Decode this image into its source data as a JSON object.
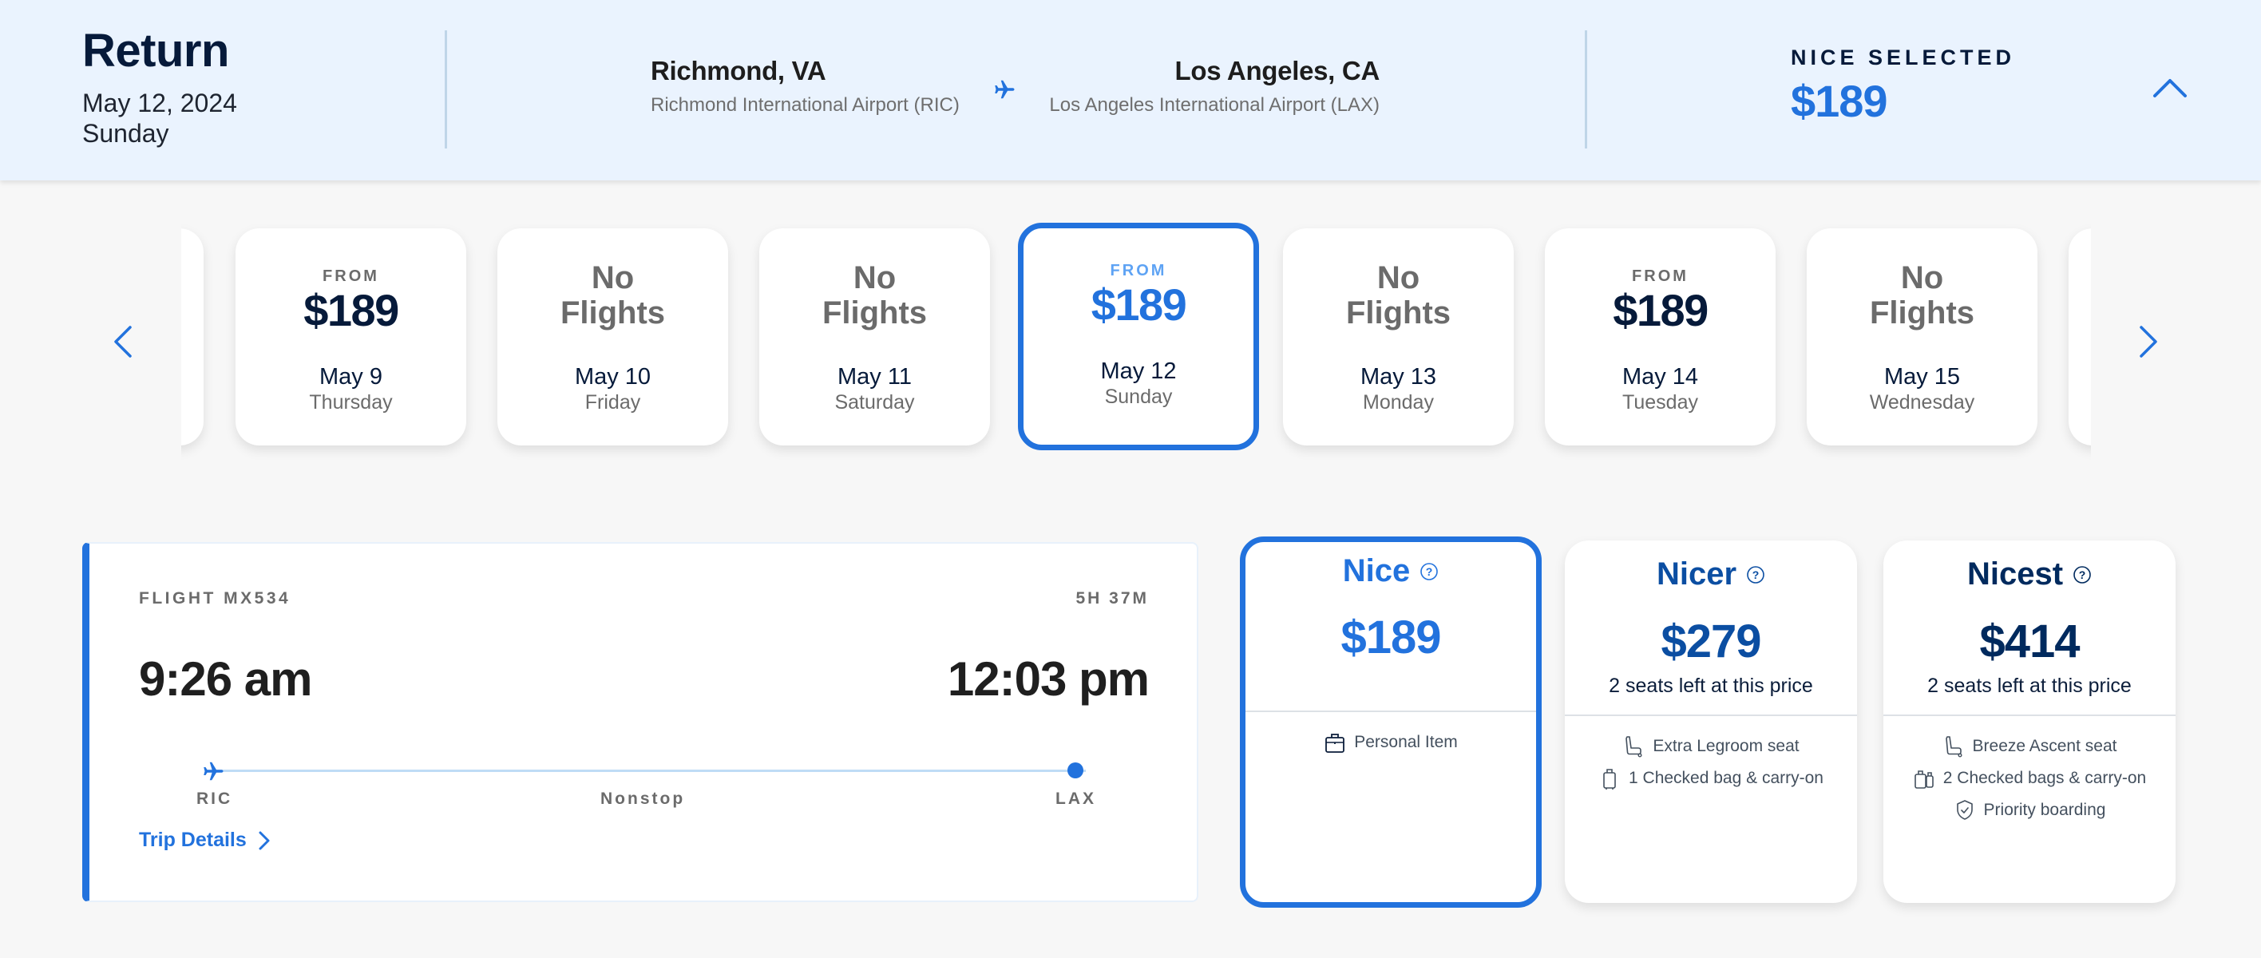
{
  "header": {
    "title": "Return",
    "date": "May 12, 2024",
    "weekday": "Sunday",
    "origin": {
      "city": "Richmond, VA",
      "airport": "Richmond International Airport (RIC)"
    },
    "destination": {
      "city": "Los Angeles, CA",
      "airport": "Los Angeles International Airport (LAX)"
    },
    "selected_label": "NICE SELECTED",
    "selected_price": "$189",
    "collapse_icon": "chevron-up-icon"
  },
  "carousel": {
    "prev_icon": "chevron-left-icon",
    "next_icon": "chevron-right-icon",
    "days": [
      {
        "from_label": "FROM",
        "price": "$189",
        "no_flights": null,
        "date": "May 9",
        "weekday": "Thursday",
        "selected": false
      },
      {
        "from_label": null,
        "price": null,
        "no_flights": "No Flights",
        "date": "May 10",
        "weekday": "Friday",
        "selected": false
      },
      {
        "from_label": null,
        "price": null,
        "no_flights": "No Flights",
        "date": "May 11",
        "weekday": "Saturday",
        "selected": false
      },
      {
        "from_label": "FROM",
        "price": "$189",
        "no_flights": null,
        "date": "May 12",
        "weekday": "Sunday",
        "selected": true
      },
      {
        "from_label": null,
        "price": null,
        "no_flights": "No Flights",
        "date": "May 13",
        "weekday": "Monday",
        "selected": false
      },
      {
        "from_label": "FROM",
        "price": "$189",
        "no_flights": null,
        "date": "May 14",
        "weekday": "Tuesday",
        "selected": false
      },
      {
        "from_label": null,
        "price": null,
        "no_flights": "No Flights",
        "date": "May 15",
        "weekday": "Wednesday",
        "selected": false
      }
    ]
  },
  "flight": {
    "number": "FLIGHT MX534",
    "duration": "5H 37M",
    "departure_time": "9:26 am",
    "arrival_time": "12:03 pm",
    "origin_code": "RIC",
    "destination_code": "LAX",
    "stops": "Nonstop",
    "trip_details_label": "Trip Details"
  },
  "fares": [
    {
      "name": "Nice",
      "price": "$189",
      "seats_left": "",
      "color": "#2272DD",
      "selected": true,
      "features": [
        {
          "icon": "briefcase-icon",
          "label": "Personal Item"
        }
      ]
    },
    {
      "name": "Nicer",
      "price": "$279",
      "seats_left": "2 seats left at this price",
      "color": "#0B4EA2",
      "selected": false,
      "features": [
        {
          "icon": "seat-icon",
          "label": "Extra Legroom seat"
        },
        {
          "icon": "suitcase-icon",
          "label": "1 Checked bag & carry-on"
        }
      ]
    },
    {
      "name": "Nicest",
      "price": "$414",
      "seats_left": "2 seats left at this price",
      "color": "#002A5E",
      "selected": false,
      "features": [
        {
          "icon": "seat-icon",
          "label": "Breeze Ascent seat"
        },
        {
          "icon": "two-suitcases-icon",
          "label": "2 Checked bags & carry-on"
        },
        {
          "icon": "shield-check-icon",
          "label": "Priority boarding"
        }
      ]
    }
  ],
  "colors": {
    "accent": "#2272DD",
    "header_bg": "#EAF3FE",
    "navy": "#061A3A",
    "muted": "#6B6B6B"
  }
}
